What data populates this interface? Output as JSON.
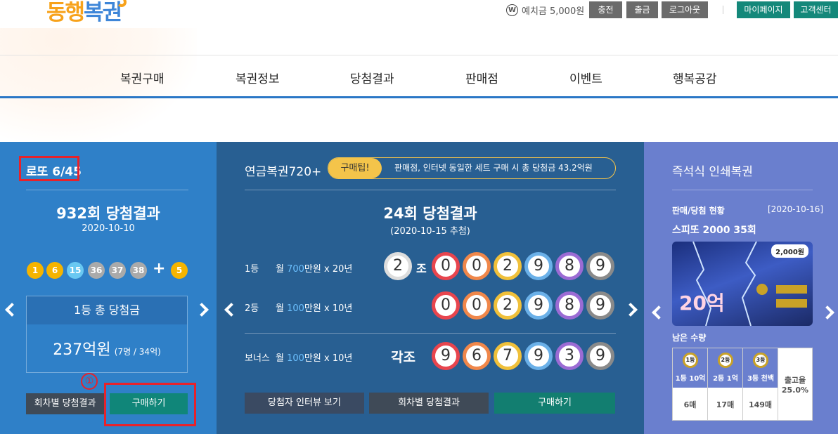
{
  "header": {
    "logo": {
      "part1": "동행",
      "part2": "복권"
    },
    "deposit_icon": "W",
    "deposit_text": "예치금 5,000원",
    "buttons": {
      "charge": "충전",
      "withdraw": "출금",
      "logout": "로그아웃",
      "mypage": "마이페이지",
      "support": "고객센터"
    }
  },
  "nav": [
    "복권구매",
    "복권정보",
    "당첨결과",
    "판매점",
    "이벤트",
    "행복공감"
  ],
  "lotto": {
    "title": "로또 6/45",
    "round_title": "932회 당첨결과",
    "date": "2020-10-10",
    "numbers": [
      {
        "n": "1",
        "color": "#f5b400"
      },
      {
        "n": "6",
        "color": "#f5b400"
      },
      {
        "n": "15",
        "color": "#69c8f2"
      },
      {
        "n": "36",
        "color": "#aaaaaa"
      },
      {
        "n": "37",
        "color": "#aaaaaa"
      },
      {
        "n": "38",
        "color": "#aaaaaa"
      }
    ],
    "plus": "+",
    "bonus": {
      "n": "5",
      "color": "#f5b400"
    },
    "prize_header": "1등 총 당첨금",
    "prize_amount": "237억원",
    "prize_detail": "(7명 / 34억)",
    "annotation_marker": "①",
    "btn_history": "회차별 당첨결과",
    "btn_buy": "구매하기"
  },
  "pension": {
    "title": "연금복권720+",
    "tip_label": "구매팁!",
    "tip_text": "판매점, 인터넷 동일한 세트 구매 시 총 당첨금 43.2억원",
    "round_title": "24회 당첨결과",
    "date": "(2020-10-15 추첨)",
    "rows": [
      {
        "rank": "1등",
        "prefix": "월 ",
        "amount": "700",
        "suffix": "만원 x ",
        "years": "20년"
      },
      {
        "rank": "2등",
        "prefix": "월 ",
        "amount": "100",
        "suffix": "만원 x ",
        "years": "10년"
      },
      {
        "rank": "보너스",
        "prefix": "월 ",
        "amount": "100",
        "suffix": "만원 x ",
        "years": "10년"
      }
    ],
    "group": {
      "n": "2",
      "label": "조"
    },
    "each_group": "각조",
    "row1_digits": [
      "0",
      "0",
      "2",
      "9",
      "8",
      "9"
    ],
    "row2_digits": [
      "0",
      "0",
      "2",
      "9",
      "8",
      "9"
    ],
    "bonus_digits": [
      "9",
      "6",
      "7",
      "9",
      "3",
      "9"
    ],
    "digit_colors": [
      "#e8454e",
      "#f0874a",
      "#f0c03a",
      "#6ab0e8",
      "#9b6bd4",
      "#8a8a8a"
    ],
    "btn_interview": "당첨자 인터뷰 보기",
    "btn_history": "회차별 당첨결과",
    "btn_buy": "구매하기"
  },
  "instant": {
    "title": "즉석식 인쇄복권",
    "status_label": "판매/당첨 현황",
    "status_date": "[2020-10-16]",
    "game_title": "스피또 2000 35회",
    "ticket_price": "2,000원",
    "ticket_prize": "20억",
    "remaining_label": "남은 수량",
    "medals": [
      {
        "badge": "1등",
        "label": "1등 10억",
        "count": "6매"
      },
      {
        "badge": "2등",
        "label": "2등 1억",
        "count": "17매"
      },
      {
        "badge": "3등",
        "label": "3등 천백",
        "count": "149매"
      }
    ],
    "release_label": "출고율",
    "release_value": "25.0%"
  }
}
